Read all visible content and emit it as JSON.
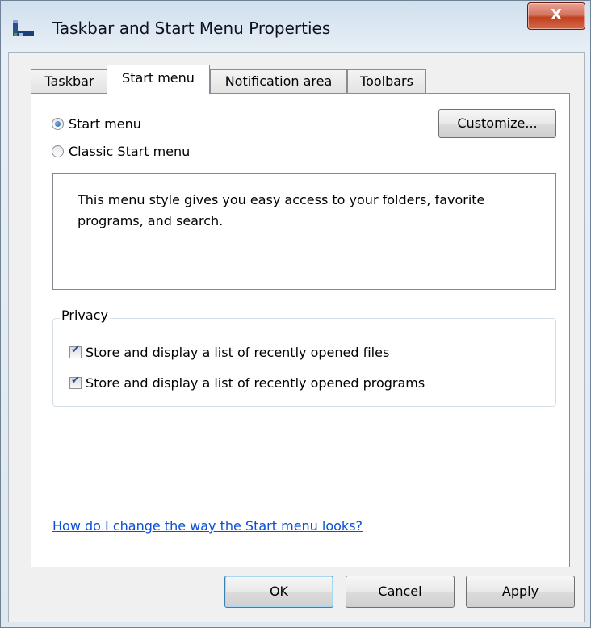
{
  "window": {
    "title": "Taskbar and Start Menu Properties",
    "close_glyph": "X",
    "icon": "taskbar-icon"
  },
  "tabs": [
    {
      "label": "Taskbar",
      "active": false
    },
    {
      "label": "Start menu",
      "active": true
    },
    {
      "label": "Notification area",
      "active": false
    },
    {
      "label": "Toolbars",
      "active": false
    }
  ],
  "start_style": {
    "options": [
      {
        "label": "Start menu",
        "selected": true
      },
      {
        "label": "Classic Start menu",
        "selected": false
      }
    ],
    "customize_label": "Customize...",
    "description": "This menu style gives you easy access to your folders, favorite programs, and search."
  },
  "privacy": {
    "group_label": "Privacy",
    "options": [
      {
        "label": "Store and display a list of recently opened files",
        "checked": true
      },
      {
        "label": "Store and display a list of recently opened programs",
        "checked": true
      }
    ]
  },
  "help_link": "How do I change the way the Start menu looks?",
  "buttons": {
    "ok": "OK",
    "cancel": "Cancel",
    "apply": "Apply"
  },
  "colors": {
    "link": "#0a4fd6",
    "close_button": "#c2401f"
  }
}
